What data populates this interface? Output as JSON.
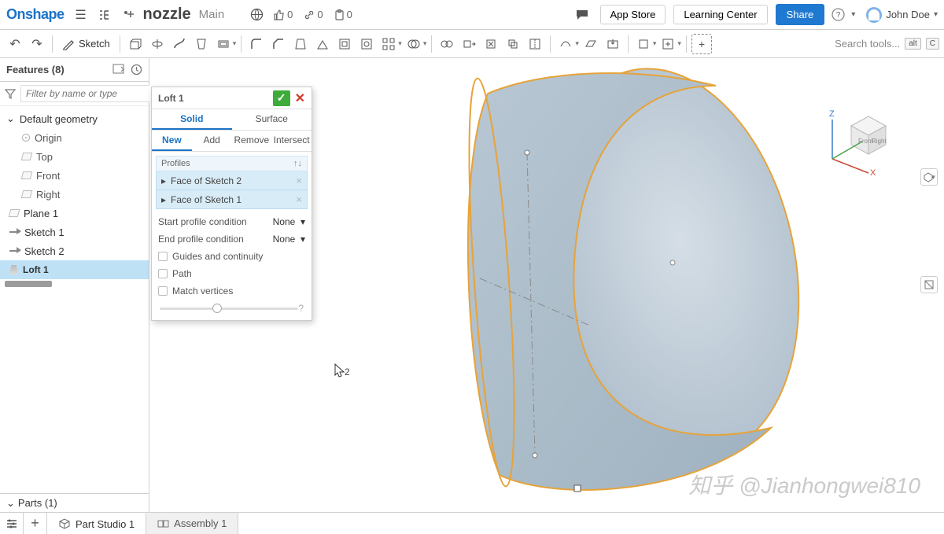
{
  "app": {
    "logo": "Onshape"
  },
  "doc": {
    "name": "nozzle",
    "branch": "Main"
  },
  "counts": {
    "likes": "0",
    "links": "0",
    "comments": "0"
  },
  "header_buttons": {
    "app_store": "App Store",
    "learning_center": "Learning Center",
    "share": "Share"
  },
  "user": {
    "name": "John Doe"
  },
  "toolbar": {
    "sketch": "Sketch",
    "search_placeholder": "Search tools...",
    "kbd1": "alt",
    "kbd2": "C"
  },
  "features": {
    "title": "Features (8)",
    "filter_placeholder": "Filter by name or type",
    "default_geometry": "Default geometry",
    "origin": "Origin",
    "top": "Top",
    "front": "Front",
    "right": "Right",
    "plane1": "Plane 1",
    "sketch1": "Sketch 1",
    "sketch2": "Sketch 2",
    "loft1": "Loft 1",
    "parts": "Parts (1)"
  },
  "loft": {
    "title": "Loft 1",
    "tab_solid": "Solid",
    "tab_surface": "Surface",
    "sub_new": "New",
    "sub_add": "Add",
    "sub_remove": "Remove",
    "sub_intersect": "Intersect",
    "profiles_label": "Profiles",
    "profile1": "Face of Sketch 2",
    "profile2": "Face of Sketch 1",
    "start_cond_label": "Start profile condition",
    "end_cond_label": "End profile condition",
    "cond_value": "None",
    "guides": "Guides and continuity",
    "path": "Path",
    "match_vertices": "Match vertices"
  },
  "axes": {
    "z": "Z",
    "x": "X",
    "front": "Front",
    "right": "Right"
  },
  "tabs": {
    "part_studio": "Part Studio 1",
    "assembly": "Assembly 1"
  },
  "watermark": "知乎 @Jianhongwei810",
  "cursor_num": "2"
}
